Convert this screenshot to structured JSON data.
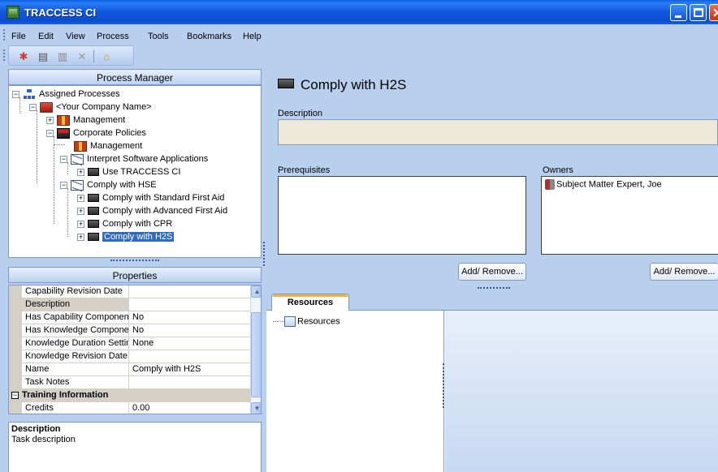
{
  "window": {
    "title": "TRACCESS CI"
  },
  "menu": [
    "File",
    "Edit",
    "View",
    "Process",
    "Tools",
    "Bookmarks",
    "Help"
  ],
  "toolbar": {
    "buttons": [
      {
        "name": "add-icon",
        "glyph": "✱"
      },
      {
        "name": "new-document-icon",
        "glyph": "▤"
      },
      {
        "name": "copy-icon",
        "glyph": "▥"
      },
      {
        "name": "delete-icon",
        "glyph": "✕"
      },
      {
        "name": "home-icon",
        "glyph": "⌂"
      }
    ]
  },
  "process_manager": {
    "header": "Process Manager",
    "tree": [
      {
        "label": "Assigned Processes",
        "icon": "org-chart-icon",
        "expander": "⊟"
      },
      {
        "label": "<Your Company Name>",
        "icon": "company-icon",
        "expander": "⊟"
      },
      {
        "label": "Management",
        "icon": "department-icon",
        "expander": "⊞"
      },
      {
        "label": "Corporate Policies",
        "icon": "corporate-icon",
        "expander": "⊟"
      },
      {
        "label": "Management",
        "icon": "department-icon",
        "expander": ""
      },
      {
        "label": "Interpret Software Applications",
        "icon": "process-icon",
        "expander": "⊟"
      },
      {
        "label": "Use TRACCESS CI",
        "icon": "task-icon",
        "expander": "⊞"
      },
      {
        "label": "Comply with HSE",
        "icon": "process-icon",
        "expander": "⊟"
      },
      {
        "label": "Comply with Standard First Aid",
        "icon": "task-icon",
        "expander": "⊞"
      },
      {
        "label": "Comply with Advanced First Aid",
        "icon": "task-icon",
        "expander": "⊞"
      },
      {
        "label": "Comply with CPR",
        "icon": "task-icon",
        "expander": "⊞"
      },
      {
        "label": "Comply with H2S",
        "icon": "task-icon",
        "expander": "⊞",
        "selected": true
      }
    ]
  },
  "properties": {
    "header": "Properties",
    "rows": [
      {
        "name": "Capability Revision Date",
        "value": ""
      },
      {
        "name": "Description",
        "value": "",
        "selected": true
      },
      {
        "name": "Has Capability Component",
        "value": "No"
      },
      {
        "name": "Has Knowledge Componer",
        "value": "No"
      },
      {
        "name": "Knowledge Duration Settin",
        "value": "None"
      },
      {
        "name": "Knowledge Revision Date",
        "value": ""
      },
      {
        "name": "Name",
        "value": "Comply with H2S"
      },
      {
        "name": "Task Notes",
        "value": ""
      }
    ],
    "category": {
      "name": "Training Information",
      "toggle": "⊟"
    },
    "category_rows": [
      {
        "name": "Credits",
        "value": "0.00"
      }
    ],
    "scroll": {
      "up": "▲",
      "down": "▼"
    }
  },
  "description_panel": {
    "title": "Description",
    "text": "Task description"
  },
  "detail": {
    "title": "Comply with H2S",
    "description_label": "Description",
    "description_value": "",
    "prerequisites_label": "Prerequisites",
    "owners_label": "Owners",
    "owners": [
      "Subject Matter Expert, Joe"
    ],
    "add_remove_label": "Add/ Remove..."
  },
  "resources": {
    "tab_label": "Resources",
    "tree_root": "Resources"
  }
}
